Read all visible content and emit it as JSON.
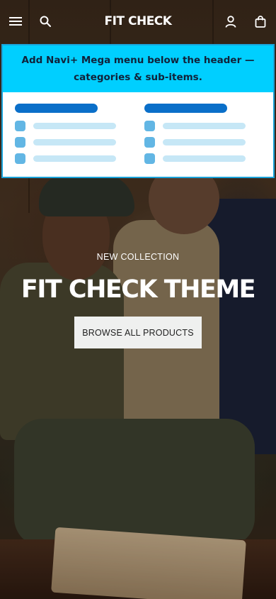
{
  "header": {
    "logo": "FIT CHECK",
    "icons": [
      "menu-icon",
      "search-icon",
      "account-icon",
      "bag-icon"
    ]
  },
  "mega_menu": {
    "banner_text": "Add Navi+ Mega menu below the header — categories & sub-items.",
    "colors": {
      "banner": "#00cfff",
      "border": "#1aa3d9",
      "heading_bar": "#0a6fc9",
      "item_square": "#62b6e4",
      "item_bar": "#c6e7f6"
    }
  },
  "hero": {
    "eyebrow": "NEW COLLECTION",
    "title": "FIT CHECK THEME",
    "cta_label": "BROWSE ALL PRODUCTS"
  }
}
